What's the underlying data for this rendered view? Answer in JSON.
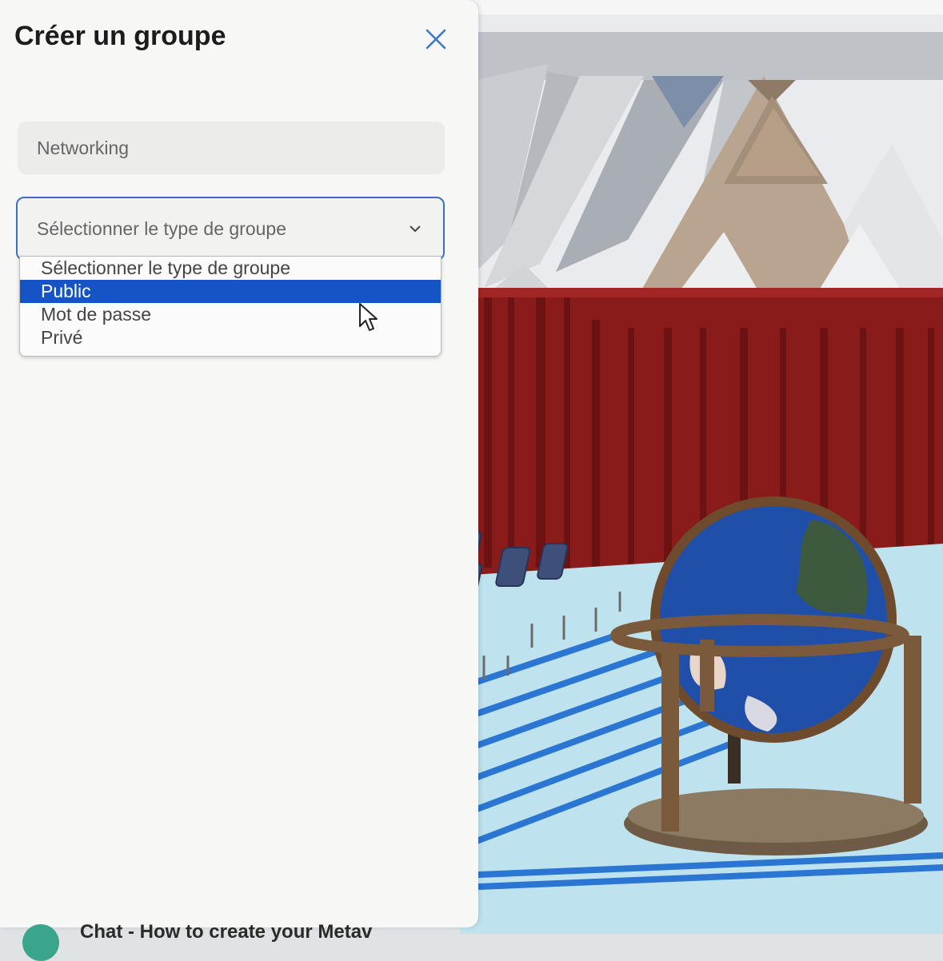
{
  "modal": {
    "title": "Créer un groupe",
    "close_icon": "close-icon",
    "name_field": {
      "value": "Networking"
    },
    "type_select": {
      "selected": "Sélectionner le type de groupe",
      "options": [
        "Sélectionner le type de groupe",
        "Public",
        "Mot de passe",
        "Privé"
      ],
      "highlighted": "Public"
    }
  },
  "footer": {
    "text": "Chat - How to create your Metav"
  },
  "colors": {
    "accent": "#3b6ec4",
    "highlight": "#1454c4",
    "curtain": "#8a1b1b",
    "floor": "#bfe3ee"
  }
}
